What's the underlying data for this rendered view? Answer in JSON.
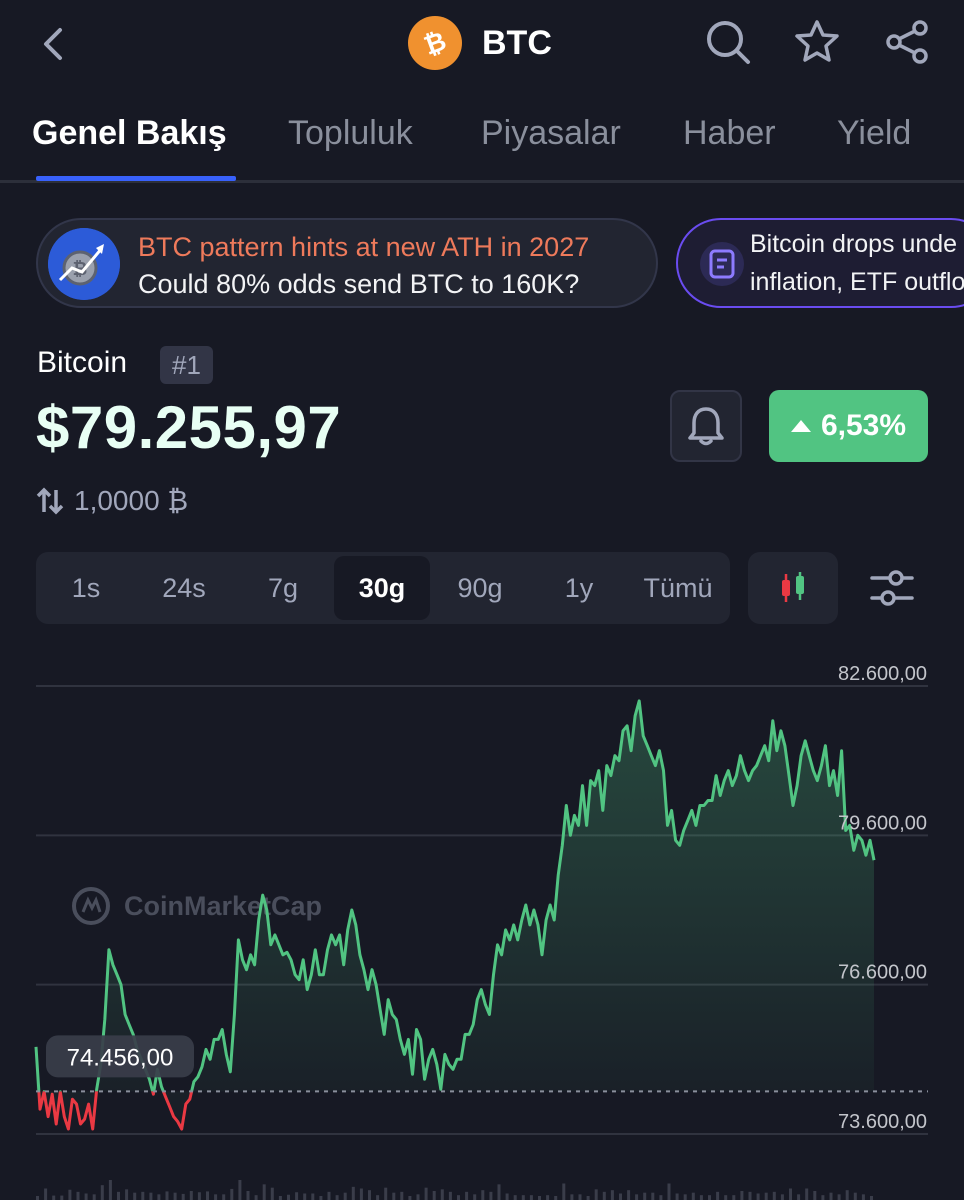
{
  "header": {
    "coin_symbol": "BTC",
    "icons": [
      "back-icon",
      "search-icon",
      "star-icon",
      "share-icon"
    ]
  },
  "tabs": [
    {
      "label": "Genel Bakış",
      "active": true
    },
    {
      "label": "Topluluk"
    },
    {
      "label": "Piyasalar"
    },
    {
      "label": "Haber"
    },
    {
      "label": "Yield"
    }
  ],
  "news": [
    {
      "title": "BTC pattern hints at new ATH in 2027",
      "subtitle": "Could 80% odds send BTC to 160K?"
    },
    {
      "line1": "Bitcoin drops unde",
      "line2": "inflation, ETF outflo"
    }
  ],
  "coin": {
    "name": "Bitcoin",
    "rank": "#1",
    "price": "$79.255,97",
    "change": "6,53%",
    "amount": "1,0000 ₿"
  },
  "ranges": [
    {
      "label": "1s"
    },
    {
      "label": "24s"
    },
    {
      "label": "7g"
    },
    {
      "label": "30g",
      "active": true
    },
    {
      "label": "90g"
    },
    {
      "label": "1y"
    },
    {
      "label": "Tümü"
    }
  ],
  "colors": {
    "accent": "#3861fb",
    "up": "#51c482",
    "down": "#ea3943",
    "background": "#171924"
  },
  "chart_data": {
    "type": "line",
    "watermark": "CoinMarketCap",
    "y_ticks": [
      "82.600,00",
      "79.600,00",
      "76.600,00",
      "73.600,00"
    ],
    "ylim": [
      73600,
      82600
    ],
    "reference_label": "74.456,00",
    "reference_value": 74456,
    "grid": true,
    "series": [
      {
        "values": [
          75350,
          74100,
          74450,
          73950,
          74400,
          73800,
          74450,
          73950,
          73700,
          74300,
          74200,
          73800,
          73900,
          74200,
          73700,
          74500,
          75000,
          75900,
          77300,
          77000,
          76800,
          76600,
          76000,
          75800,
          75600,
          75300,
          75100,
          74900,
          74700,
          74400,
          74900,
          74550,
          74350,
          74150,
          73950,
          73850,
          73700,
          74200,
          74300,
          74650,
          74750,
          74950,
          75300,
          75100,
          75500,
          75500,
          75700,
          75200,
          74850,
          76000,
          77500,
          77100,
          76900,
          77200,
          77000,
          77900,
          78400,
          78100,
          77400,
          77600,
          77400,
          77200,
          77250,
          77100,
          76800,
          76700,
          77100,
          76500,
          76800,
          77300,
          76800,
          76800,
          77300,
          77600,
          77400,
          77600,
          77000,
          77700,
          78100,
          77800,
          77200,
          76900,
          76500,
          76900,
          76600,
          76100,
          75600,
          76300,
          76000,
          75900,
          75500,
          75200,
          75500,
          74800,
          75700,
          75500,
          74700,
          75100,
          75300,
          75000,
          74500,
          75200,
          75000,
          74900,
          75100,
          75100,
          75600,
          75600,
          75800,
          76300,
          76500,
          76200,
          76000,
          76800,
          77400,
          77200,
          77700,
          77500,
          77800,
          77500,
          77900,
          78200,
          77800,
          78100,
          77800,
          77200,
          77900,
          78200,
          77900,
          78800,
          79400,
          80200,
          79600,
          80000,
          79800,
          80600,
          79800,
          80700,
          80600,
          80900,
          80100,
          81000,
          80800,
          81200,
          81100,
          81700,
          81800,
          81300,
          82000,
          82300,
          81600,
          81400,
          81200,
          81000,
          81300,
          80900,
          79800,
          80100,
          79500,
          79400,
          79700,
          79900,
          80100,
          79800,
          80200,
          80200,
          80300,
          80300,
          80800,
          80400,
          80700,
          80900,
          80600,
          80800,
          81200,
          80900,
          80700,
          80900,
          81000,
          81200,
          81400,
          81100,
          81900,
          81300,
          81700,
          81400,
          80800,
          80200,
          80600,
          81200,
          81500,
          81200,
          80900,
          80700,
          81000,
          81400,
          80600,
          80900,
          80400,
          81300,
          79700,
          79800,
          79300,
          79600,
          79500,
          79200,
          79500,
          79100
        ]
      }
    ]
  }
}
